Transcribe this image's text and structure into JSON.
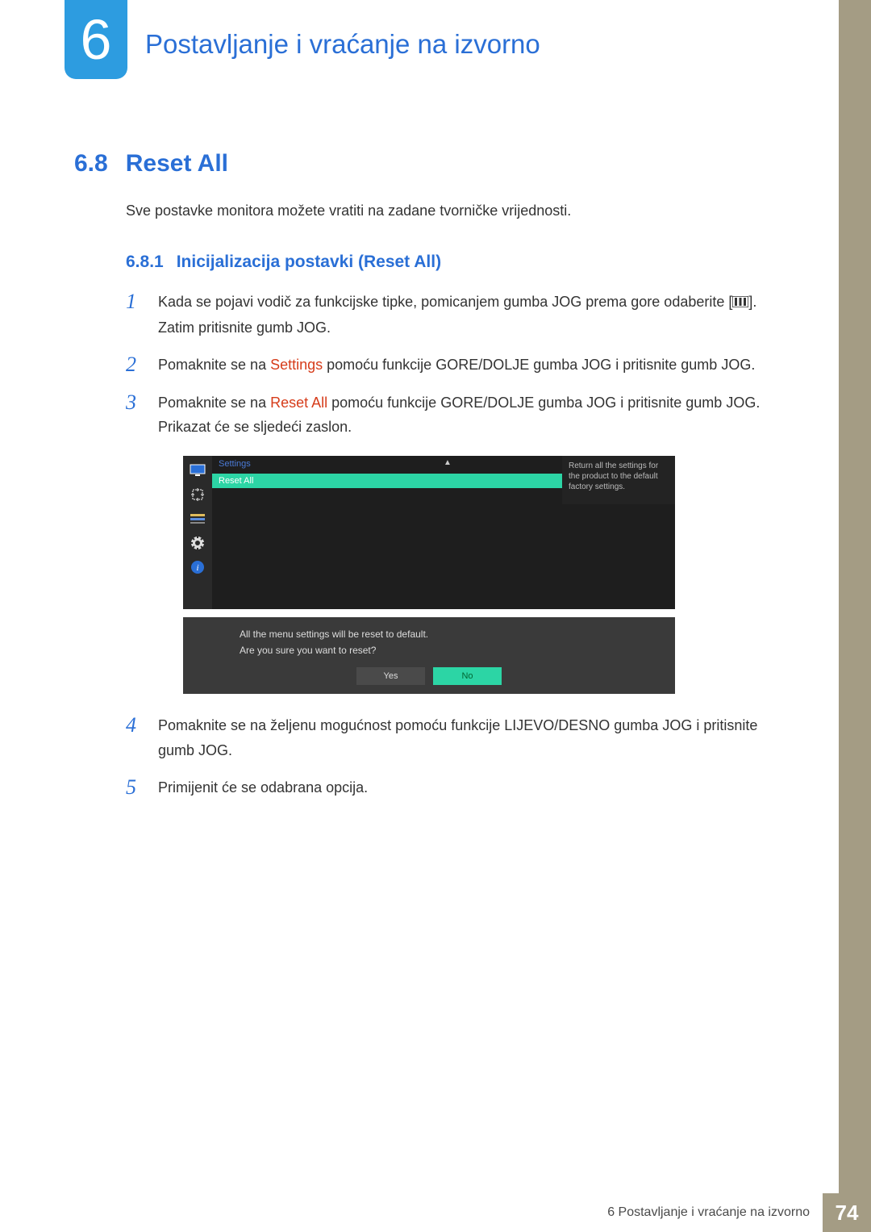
{
  "chapter": {
    "number": "6",
    "title": "Postavljanje i vraćanje na izvorno"
  },
  "section": {
    "number": "6.8",
    "title": "Reset All"
  },
  "intro": "Sve postavke monitora možete vratiti na zadane tvorničke vrijednosti.",
  "subsection": {
    "number": "6.8.1",
    "title": "Inicijalizacija postavki (Reset All)"
  },
  "steps": {
    "s1a": "Kada se pojavi vodič za funkcijske tipke, pomicanjem gumba JOG prema gore odaberite [",
    "s1b": "]. Zatim pritisnite gumb JOG.",
    "s2a": "Pomaknite se na ",
    "s2kw": "Settings",
    "s2b": " pomoću funkcije GORE/DOLJE gumba JOG i pritisnite gumb JOG.",
    "s3a": "Pomaknite se na ",
    "s3kw": "Reset All",
    "s3b": " pomoću funkcije GORE/DOLJE gumba JOG i pritisnite gumb JOG. Prikazat će se sljedeći zaslon.",
    "s4": "Pomaknite se na željenu mogućnost pomoću funkcije LIJEVO/DESNO gumba JOG i pritisnite gumb JOG.",
    "s5": "Primijenit će se odabrana opcija.",
    "n1": "1",
    "n2": "2",
    "n3": "3",
    "n4": "4",
    "n5": "5"
  },
  "osd": {
    "menuTitle": "Settings",
    "highlighted": "Reset All",
    "help": "Return all the settings for the product to the default factory settings.",
    "dialogLine1": "All the menu settings will be reset to default.",
    "dialogLine2": "Are you sure you want to reset?",
    "yes": "Yes",
    "no": "No"
  },
  "footer": {
    "text": "6 Postavljanje i vraćanje na izvorno",
    "page": "74"
  }
}
